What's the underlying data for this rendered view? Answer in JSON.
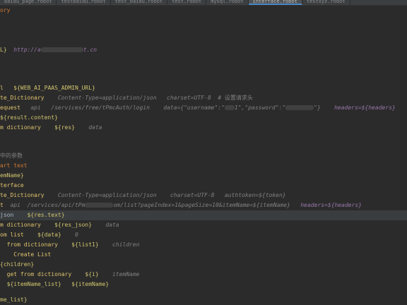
{
  "tabs": [
    {
      "label": "baidu_page.robot",
      "active": false
    },
    {
      "label": "testbaidu.robot",
      "active": false
    },
    {
      "label": "test_baidu.robot",
      "active": false
    },
    {
      "label": "test.robot",
      "active": false
    },
    {
      "label": "mysql.robot",
      "active": false
    },
    {
      "label": "interface.robot",
      "active": true
    },
    {
      "label": "testxyz.robot",
      "active": false
    }
  ],
  "code": {
    "l1": "ory",
    "l2a": "L}",
    "l2b": "http://a",
    "l2c": "t.cn",
    "l3a": "l",
    "l3b": "${WEB_AI_PAAS_ADMIN_URL}",
    "l4a": "te_Dictionary",
    "l4b": "Content-Type=application/json",
    "l4c": "charset=UTF-8",
    "l4d": "# 设置请求头",
    "l5a": "equest",
    "l5b": "api",
    "l5c": "/services/free/tPmcAuth/login",
    "l5d": "data={\"username\":\"",
    "l5e": "1\",\"password\":\"",
    "l5f": "\"}",
    "l5g": "headers=${headers}",
    "l6": "${result.content}",
    "l7a": "m dictionary",
    "l7b": "${res}",
    "l7c": "data",
    "l8": "中的参数",
    "l9": "art text",
    "l10": "emName}",
    "l11": "terface",
    "l12a": "te_Dictionary",
    "l12b": "Content-Type=application/json",
    "l12c": "charset=UTF-8",
    "l12d": "authtoken=${token}",
    "l13a": "t",
    "l13b": "api",
    "l13c": "/services/api/tPm",
    "l13d": "om/list?pageIndex=1&pageSize=10&itemName=${itemName}",
    "l13e": "headers=${headers}",
    "l14a": "json",
    "l14b": "${res.text}",
    "l15a": "m dictionary",
    "l15b": "${res_json}",
    "l15c": "data",
    "l16a": "om list",
    "l16b": "${data}",
    "l16c": "0",
    "l17a": "from dictionary",
    "l17b": "${list1}",
    "l17c": "children",
    "l18": "Create List",
    "l19": "{children}",
    "l20a": "get from dictionary",
    "l20b": "${i}",
    "l20c": "itemName",
    "l21a": "${itemName_list}",
    "l21b": "${itemName}",
    "l22": "me_list}"
  }
}
